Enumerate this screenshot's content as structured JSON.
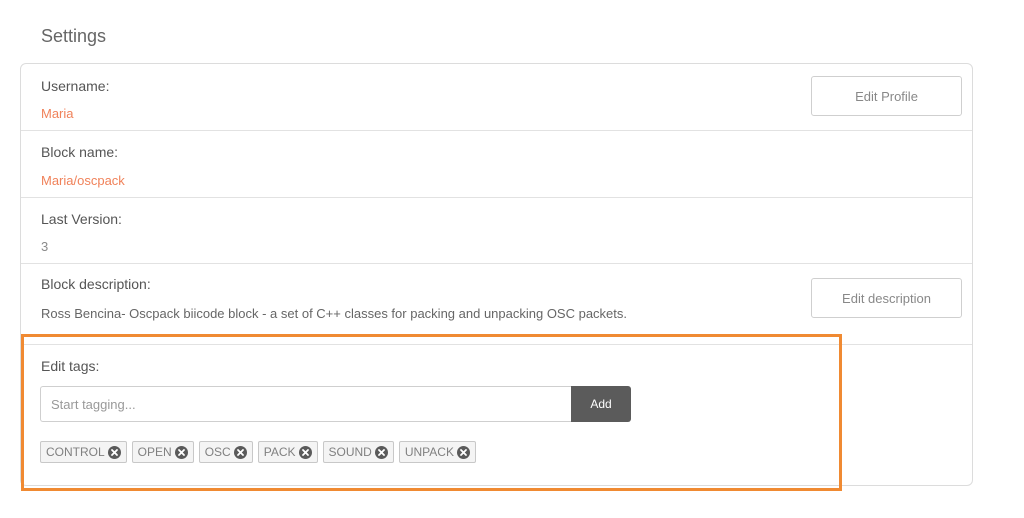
{
  "page": {
    "title": "Settings"
  },
  "username": {
    "label": "Username:",
    "value": "Maria",
    "button_label": "Edit Profile"
  },
  "block_name": {
    "label": "Block name:",
    "value": "Maria/oscpack"
  },
  "last_version": {
    "label": "Last Version:",
    "value": "3"
  },
  "block_description": {
    "label": "Block description:",
    "value": "Ross Bencina- Oscpack biicode block - a set of C++ classes for packing and unpacking OSC packets.",
    "button_label": "Edit description"
  },
  "tags": {
    "label": "Edit tags:",
    "input_placeholder": "Start tagging...",
    "input_value": "",
    "add_label": "Add",
    "items": [
      {
        "label": "CONTROL",
        "icon": "remove-circle-icon"
      },
      {
        "label": "OPEN",
        "icon": "remove-circle-icon"
      },
      {
        "label": "OSC",
        "icon": "remove-circle-icon"
      },
      {
        "label": "PACK",
        "icon": "remove-circle-icon"
      },
      {
        "label": "SOUND",
        "icon": "remove-circle-icon"
      },
      {
        "label": "UNPACK",
        "icon": "remove-circle-icon"
      }
    ]
  },
  "colors": {
    "accent": "#f0825a",
    "highlight": "#f08a32",
    "add_button": "#5b5b5b"
  }
}
